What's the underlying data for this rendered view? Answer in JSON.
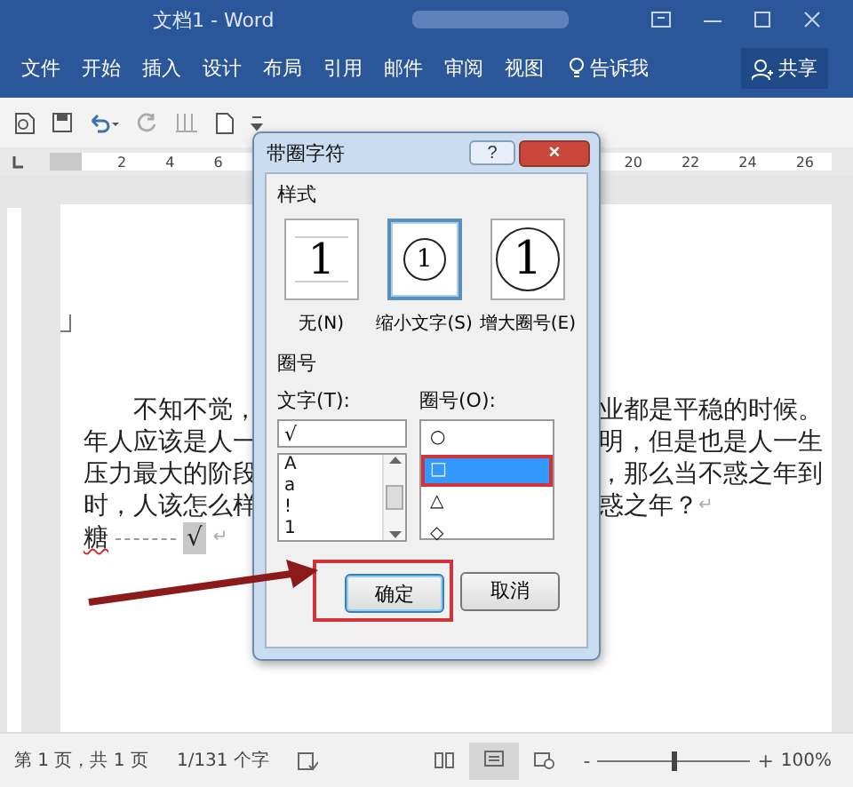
{
  "window": {
    "title": "文档1 - Word"
  },
  "ribbon": {
    "tabs": [
      {
        "label": "文件",
        "selected": false
      },
      {
        "label": "开始",
        "selected": false
      },
      {
        "label": "插入",
        "selected": false
      },
      {
        "label": "设计",
        "selected": false
      },
      {
        "label": "布局",
        "selected": false
      },
      {
        "label": "引用",
        "selected": false
      },
      {
        "label": "邮件",
        "selected": false
      },
      {
        "label": "审阅",
        "selected": false
      },
      {
        "label": "视图",
        "selected": false
      }
    ],
    "tell_me": "告诉我",
    "share": "共享"
  },
  "ruler": {
    "left_numbers": [
      "2",
      "4",
      "6"
    ],
    "right_numbers": [
      "20",
      "22",
      "24",
      "26"
    ]
  },
  "document": {
    "lines": [
      {
        "left": "不知不觉，",
        "right": "业都是平稳的时候。"
      },
      {
        "left": "年人应该是人一",
        "right": "明，但是也是人一生"
      },
      {
        "left": "压力最大的阶段",
        "right": "，那么当不惑之年到"
      },
      {
        "left": "时，人该怎么样",
        "right": "惑之年？",
        "end_mark": "↵"
      },
      {
        "left": "糖",
        "marked_char": "√",
        "end_mark": "↵"
      }
    ]
  },
  "dialog": {
    "title": "带圈字符",
    "help": "?",
    "close": "×",
    "style_label": "样式",
    "styles": [
      {
        "preview": "1",
        "label": "无(N)",
        "kind": "none",
        "selected": false
      },
      {
        "preview": "1",
        "label": "缩小文字(S)",
        "kind": "shrink",
        "selected": true
      },
      {
        "preview": "1",
        "label": "增大圈号(E)",
        "kind": "enlarge",
        "selected": false
      }
    ],
    "enclosure_label": "圈号",
    "text_label": "文字(T):",
    "text_value": "√",
    "text_options": [
      "A",
      "a",
      "!",
      "1"
    ],
    "shape_label": "圈号(O):",
    "shapes": [
      {
        "label": "○",
        "selected": false,
        "highlighted": false
      },
      {
        "label": "□",
        "selected": true,
        "highlighted": true
      },
      {
        "label": "△",
        "selected": false,
        "highlighted": false
      },
      {
        "label": "◇",
        "selected": false,
        "highlighted": false
      }
    ],
    "buttons": [
      {
        "label": "确定",
        "default": true,
        "highlighted": true
      },
      {
        "label": "取消",
        "default": false,
        "highlighted": false
      }
    ]
  },
  "annotation_arrow": true,
  "status_bar": {
    "page": "第 1 页，共 1 页",
    "words": "1/131 个字",
    "zoom": {
      "level": 0.5,
      "minus": "-",
      "plus": "+"
    },
    "zoom_text": "100%"
  }
}
